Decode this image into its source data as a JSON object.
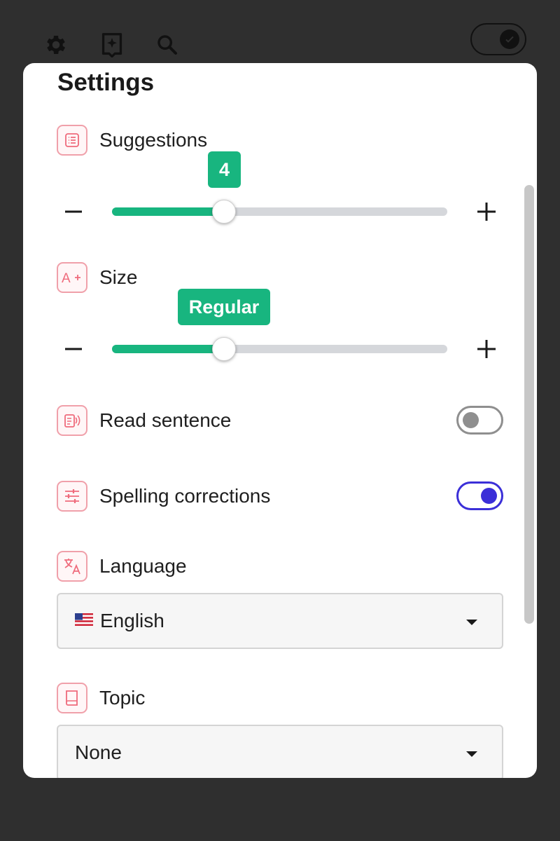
{
  "toolbar": {
    "icons": [
      "gear-icon",
      "sparkle-bookmark-icon",
      "search-icon"
    ],
    "dark_mode_toggle": "on"
  },
  "panel": {
    "title": "Settings"
  },
  "suggestions": {
    "label": "Suggestions",
    "icon": "list-icon",
    "value_label": "4",
    "slider_fraction": 0.33,
    "decrease": "−",
    "increase": "+"
  },
  "size": {
    "label": "Size",
    "icon": "text-size-icon",
    "value_label": "Regular",
    "slider_fraction": 0.33,
    "decrease": "−",
    "increase": "+"
  },
  "read_sentence": {
    "label": "Read sentence",
    "icon": "speaker-document-icon",
    "enabled": false
  },
  "spelling": {
    "label": "Spelling corrections",
    "icon": "sliders-icon",
    "enabled": true
  },
  "language": {
    "label": "Language",
    "icon": "translate-icon",
    "selected": "English",
    "flag": "us-flag-icon"
  },
  "topic": {
    "label": "Topic",
    "icon": "book-icon",
    "selected": "None"
  },
  "colors": {
    "accent_green": "#18b57f",
    "accent_blue": "#3b2fd8",
    "icon_pink": "#f0a0aa"
  }
}
